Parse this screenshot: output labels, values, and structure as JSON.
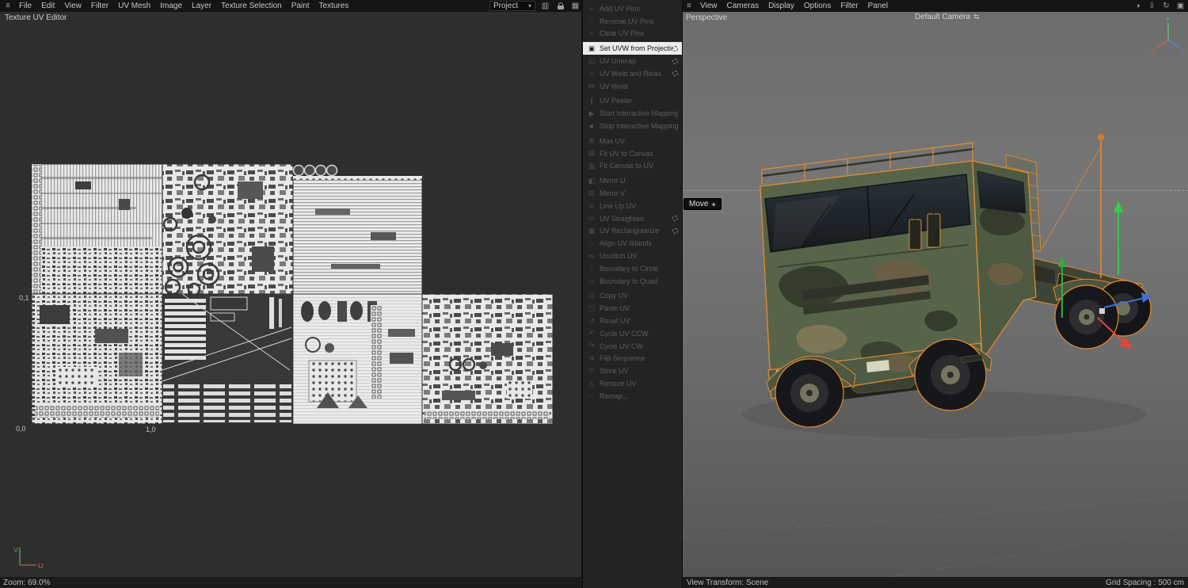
{
  "top_bar": {
    "left_menus": [
      "File",
      "Edit",
      "View",
      "Filter",
      "UV Mesh",
      "Image",
      "Layer",
      "Texture Selection",
      "Paint",
      "Textures"
    ],
    "project_dropdown": "Project",
    "right_menus": [
      "View",
      "Cameras",
      "Display",
      "Options",
      "Filter",
      "Panel"
    ]
  },
  "uv_editor": {
    "title": "Texture UV Editor",
    "zoom_status": "Zoom: 69.0%",
    "coord_labels": {
      "top_left": "0,1",
      "bottom_left": "0,0",
      "bottom_right": "1,0"
    },
    "axis": {
      "u": "U",
      "v": "V"
    }
  },
  "uv_menu": {
    "items": [
      {
        "label": "Add UV Pins",
        "icon": "+",
        "enabled": false,
        "gear": false,
        "selected": false,
        "sep_before": false
      },
      {
        "label": "Remove UV Pins",
        "icon": "−",
        "enabled": false,
        "gear": false,
        "selected": false,
        "sep_before": false
      },
      {
        "label": "Clear UV Pins",
        "icon": "×",
        "enabled": false,
        "gear": false,
        "selected": false,
        "sep_before": false
      },
      {
        "label": "Set UVW from Projection",
        "icon": "▣",
        "enabled": true,
        "gear": true,
        "selected": true,
        "sep_before": true
      },
      {
        "label": "UV Unwrap",
        "icon": "◱",
        "enabled": false,
        "gear": true,
        "selected": false,
        "sep_before": false
      },
      {
        "label": "UV Weld and Relax",
        "icon": "≈",
        "enabled": false,
        "gear": true,
        "selected": false,
        "sep_before": false
      },
      {
        "label": "UV Weld",
        "icon": "⋈",
        "enabled": false,
        "gear": false,
        "selected": false,
        "sep_before": false
      },
      {
        "label": "UV Peeler",
        "icon": "∥",
        "enabled": false,
        "gear": false,
        "selected": false,
        "sep_before": true
      },
      {
        "label": "Start Interactive Mapping",
        "icon": "▶",
        "enabled": false,
        "gear": false,
        "selected": false,
        "sep_before": false
      },
      {
        "label": "Stop Interactive Mapping",
        "icon": "■",
        "enabled": false,
        "gear": false,
        "selected": false,
        "sep_before": false
      },
      {
        "label": "Max UV",
        "icon": "⊞",
        "enabled": false,
        "gear": false,
        "selected": false,
        "sep_before": true
      },
      {
        "label": "Fit UV to Canvas",
        "icon": "▤",
        "enabled": false,
        "gear": false,
        "selected": false,
        "sep_before": false
      },
      {
        "label": "Fit Canvas to UV",
        "icon": "▥",
        "enabled": false,
        "gear": false,
        "selected": false,
        "sep_before": false
      },
      {
        "label": "Mirror U",
        "icon": "◧",
        "enabled": false,
        "gear": false,
        "selected": false,
        "sep_before": true
      },
      {
        "label": "Mirror V",
        "icon": "⊟",
        "enabled": false,
        "gear": false,
        "selected": false,
        "sep_before": false
      },
      {
        "label": "Line Up UV",
        "icon": "≡",
        "enabled": false,
        "gear": false,
        "selected": false,
        "sep_before": false
      },
      {
        "label": "UV Straighten",
        "icon": "▭",
        "enabled": false,
        "gear": true,
        "selected": false,
        "sep_before": false
      },
      {
        "label": "UV Rectangularize",
        "icon": "▦",
        "enabled": false,
        "gear": true,
        "selected": false,
        "sep_before": false
      },
      {
        "label": "Align UV Islands",
        "icon": "∷",
        "enabled": false,
        "gear": false,
        "selected": false,
        "sep_before": false
      },
      {
        "label": "Unstitch UV",
        "icon": "✂",
        "enabled": false,
        "gear": false,
        "selected": false,
        "sep_before": false
      },
      {
        "label": "Boundary to Circle",
        "icon": "○",
        "enabled": false,
        "gear": false,
        "selected": false,
        "sep_before": false
      },
      {
        "label": "Boundary to Quad",
        "icon": "□",
        "enabled": false,
        "gear": false,
        "selected": false,
        "sep_before": false
      },
      {
        "label": "Copy UV",
        "icon": "⊡",
        "enabled": false,
        "gear": false,
        "selected": false,
        "sep_before": true
      },
      {
        "label": "Paste UV",
        "icon": "▢",
        "enabled": false,
        "gear": false,
        "selected": false,
        "sep_before": false
      },
      {
        "label": "Reset UV",
        "icon": "↺",
        "enabled": false,
        "gear": false,
        "selected": false,
        "sep_before": false
      },
      {
        "label": "Cycle UV CCW",
        "icon": "↶",
        "enabled": false,
        "gear": false,
        "selected": false,
        "sep_before": false
      },
      {
        "label": "Cycle UV CW",
        "icon": "↷",
        "enabled": false,
        "gear": false,
        "selected": false,
        "sep_before": false
      },
      {
        "label": "Flip Sequence",
        "icon": "⇅",
        "enabled": false,
        "gear": false,
        "selected": false,
        "sep_before": false
      },
      {
        "label": "Store UV",
        "icon": "▽",
        "enabled": false,
        "gear": false,
        "selected": false,
        "sep_before": false
      },
      {
        "label": "Restore UV",
        "icon": "△",
        "enabled": false,
        "gear": false,
        "selected": false,
        "sep_before": false
      },
      {
        "label": "Remap...",
        "icon": "⋯",
        "enabled": false,
        "gear": false,
        "selected": false,
        "sep_before": false
      }
    ]
  },
  "viewport": {
    "label": "Perspective",
    "camera_label": "Default Camera",
    "tool_tooltip": "Move",
    "status_left": "View Transform: Scene",
    "status_right": "Grid Spacing : 500 cm",
    "axis_labels": {
      "x": "X",
      "y": "Y",
      "z": "Z"
    }
  },
  "colors": {
    "selection_outline": "#e68b2d",
    "axis_x": "#e0483a",
    "axis_y": "#38c94e",
    "axis_z": "#3f6fd0"
  }
}
